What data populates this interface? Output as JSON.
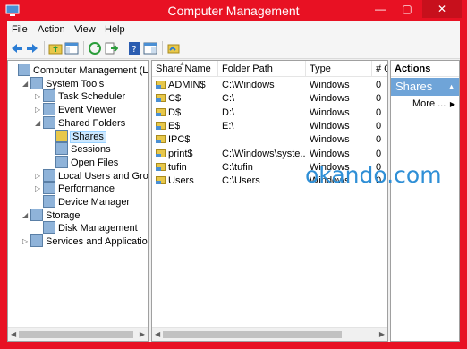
{
  "window": {
    "title": "Computer Management",
    "minimize": "—",
    "maximize": "▢",
    "close": "✕"
  },
  "menu": [
    "File",
    "Action",
    "View",
    "Help"
  ],
  "toolbar": [
    "back-arrow-icon",
    "forward-arrow-icon",
    "up-folder-icon",
    "show-hide-tree-icon",
    "refresh-icon",
    "export-list-icon",
    "help-icon",
    "properties-icon",
    "share-icon"
  ],
  "tree": [
    {
      "label": "Computer Management (Local",
      "indent": 0,
      "expander": "",
      "icon": "computer-icon"
    },
    {
      "label": "System Tools",
      "indent": 1,
      "expander": "◢",
      "icon": "tools-icon"
    },
    {
      "label": "Task Scheduler",
      "indent": 2,
      "expander": "▷",
      "icon": "clock-icon"
    },
    {
      "label": "Event Viewer",
      "indent": 2,
      "expander": "▷",
      "icon": "event-viewer-icon"
    },
    {
      "label": "Shared Folders",
      "indent": 2,
      "expander": "◢",
      "icon": "shared-folder-icon"
    },
    {
      "label": "Shares",
      "indent": 3,
      "expander": "",
      "icon": "share-icon",
      "selected": true
    },
    {
      "label": "Sessions",
      "indent": 3,
      "expander": "",
      "icon": "sessions-icon"
    },
    {
      "label": "Open Files",
      "indent": 3,
      "expander": "",
      "icon": "open-files-icon"
    },
    {
      "label": "Local Users and Groups",
      "indent": 2,
      "expander": "▷",
      "icon": "users-icon"
    },
    {
      "label": "Performance",
      "indent": 2,
      "expander": "▷",
      "icon": "performance-icon"
    },
    {
      "label": "Device Manager",
      "indent": 2,
      "expander": "",
      "icon": "device-manager-icon"
    },
    {
      "label": "Storage",
      "indent": 1,
      "expander": "◢",
      "icon": "storage-icon"
    },
    {
      "label": "Disk Management",
      "indent": 2,
      "expander": "",
      "icon": "disk-icon"
    },
    {
      "label": "Services and Applications",
      "indent": 1,
      "expander": "▷",
      "icon": "services-icon"
    }
  ],
  "list": {
    "columns": [
      "Share Name",
      "Folder Path",
      "Type",
      "# C"
    ],
    "rows": [
      [
        "ADMIN$",
        "C:\\Windows",
        "Windows",
        "0"
      ],
      [
        "C$",
        "C:\\",
        "Windows",
        "0"
      ],
      [
        "D$",
        "D:\\",
        "Windows",
        "0"
      ],
      [
        "E$",
        "E:\\",
        "Windows",
        "0"
      ],
      [
        "IPC$",
        "",
        "Windows",
        "0"
      ],
      [
        "print$",
        "C:\\Windows\\syste...",
        "Windows",
        "0"
      ],
      [
        "tufin",
        "C:\\tufin",
        "Windows",
        "0"
      ],
      [
        "Users",
        "C:\\Users",
        "Windows",
        "0"
      ]
    ]
  },
  "actions": {
    "header": "Actions",
    "section": "Shares",
    "more": "More ...",
    "collapse": "▲",
    "more_arrow": "▶"
  },
  "watermark": "okando.com",
  "colors": {
    "frame": "#e81123",
    "selection": "#cce8ff",
    "actions_section": "#6fa4d8",
    "watermark": "#2f8fd6"
  }
}
